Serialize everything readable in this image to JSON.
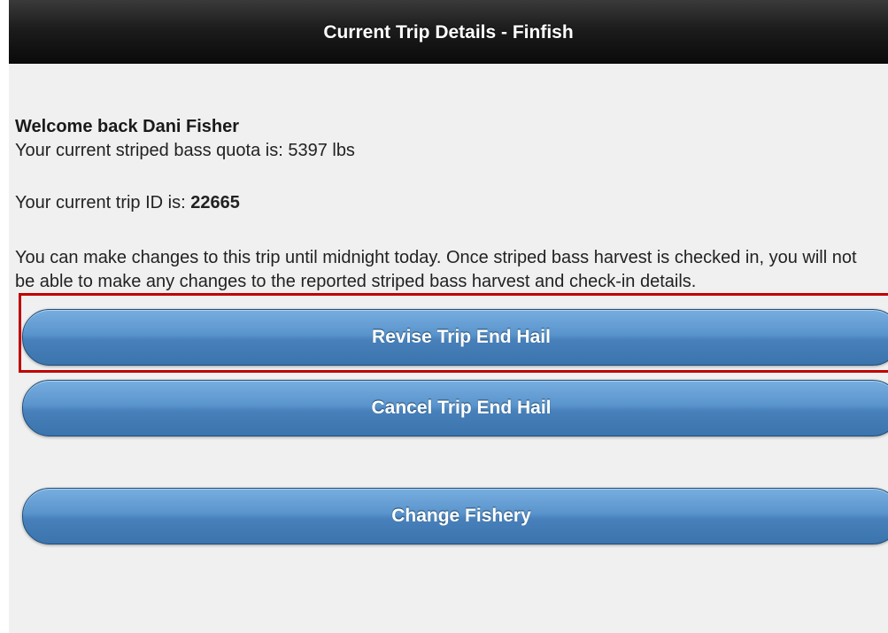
{
  "header": {
    "title": "Current Trip Details - Finfish"
  },
  "main": {
    "welcome": "Welcome back Dani Fisher",
    "quota_text": "Your current striped bass quota is: 5397 lbs",
    "trip_id_prefix": "Your current trip ID is: ",
    "trip_id_value": "22665",
    "notice": "You can make changes to this trip until midnight today. Once striped bass harvest is checked in, you will not be able to make any changes to the reported striped bass harvest and check-in details."
  },
  "buttons": {
    "revise_label": "Revise Trip End Hail",
    "cancel_label": "Cancel Trip End Hail",
    "change_label": "Change Fishery"
  },
  "colors": {
    "header_bg": "#111111",
    "button_blue": "#5a94cc",
    "highlight_red": "#c00000",
    "page_bg": "#f0f0f0"
  }
}
